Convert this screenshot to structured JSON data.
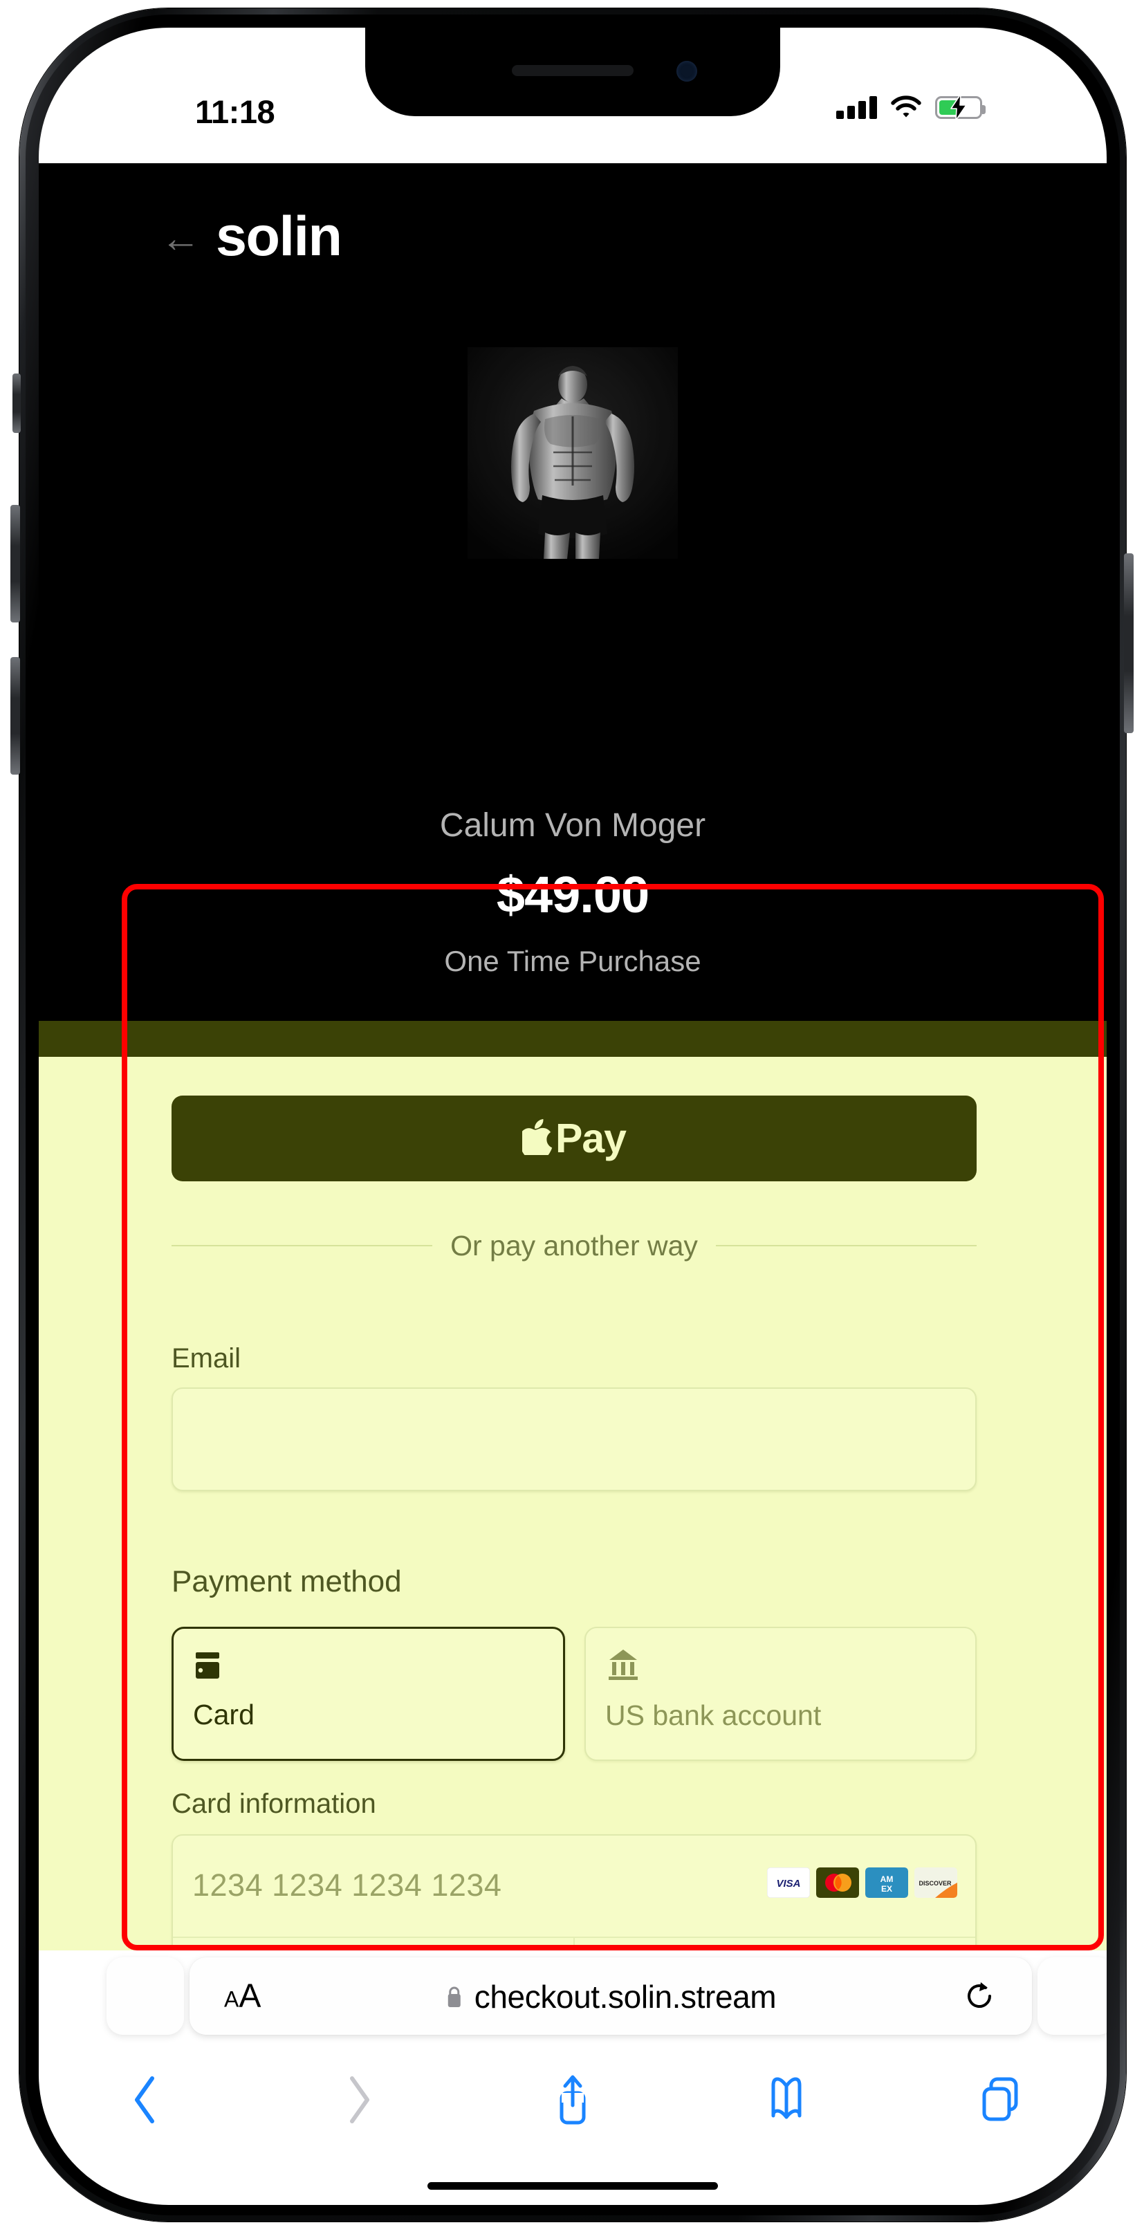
{
  "status_bar": {
    "time": "11:18",
    "signal_icon": "cellular-signal-icon",
    "wifi_icon": "wifi-icon",
    "battery_icon": "battery-charging-icon",
    "battery_color": "#2fcb55"
  },
  "page": {
    "back_arrow": "←",
    "brand": "solin",
    "product_name": "Calum Von Moger",
    "price": "$49.00",
    "purchase_type": "One Time Purchase",
    "product_image_alt": "bodybuilder-photo"
  },
  "checkout": {
    "apple_pay_label": "Pay",
    "apple_pay_icon": "apple-logo-icon",
    "divider_text": "Or pay another way",
    "email_label": "Email",
    "email_value": "",
    "email_placeholder": "",
    "payment_method_label": "Payment method",
    "payment_methods": [
      {
        "label": "Card",
        "icon": "credit-card-icon",
        "selected": true
      },
      {
        "label": "US bank account",
        "icon": "bank-icon",
        "selected": false
      }
    ],
    "card_information_label": "Card information",
    "card_number_placeholder": "1234 1234 1234 1234",
    "card_brands": [
      "visa",
      "mastercard",
      "amex",
      "discover"
    ],
    "sheet_bg": "#f4fbc1",
    "accent": "#3b4206"
  },
  "annotation": {
    "highlight_color": "#fe0000"
  },
  "safari": {
    "text_size_button": {
      "small_a": "A",
      "large_a": "A"
    },
    "lock_icon": "lock-icon",
    "url": "checkout.solin.stream",
    "reload_icon": "reload-icon",
    "toolbar": [
      {
        "name": "back",
        "icon": "chevron-left-icon",
        "enabled": true
      },
      {
        "name": "forward",
        "icon": "chevron-right-icon",
        "enabled": false
      },
      {
        "name": "share",
        "icon": "share-icon",
        "enabled": true
      },
      {
        "name": "bookmarks",
        "icon": "book-icon",
        "enabled": true
      },
      {
        "name": "tabs",
        "icon": "tabs-icon",
        "enabled": true
      }
    ]
  }
}
